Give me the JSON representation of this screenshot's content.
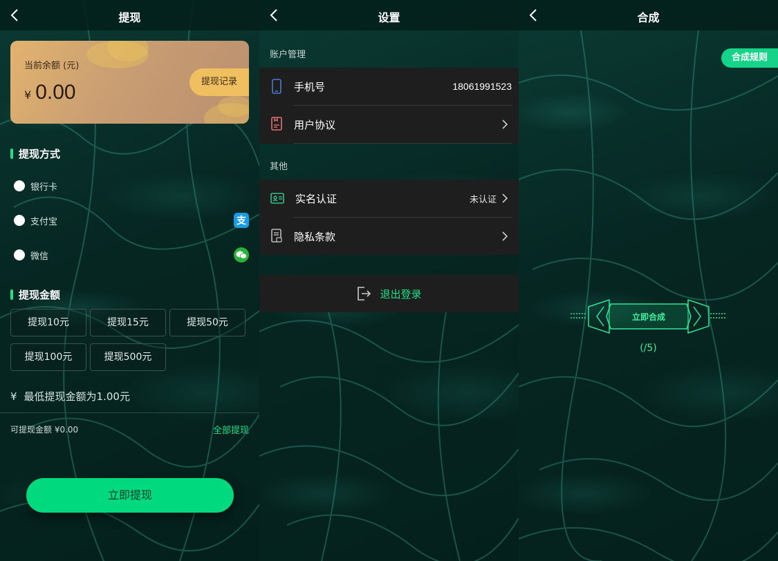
{
  "withdraw": {
    "title": "提现",
    "balance_label": "当前余额 (元)",
    "currency": "¥",
    "balance": "0.00",
    "record_button": "提现记录",
    "method_title": "提现方式",
    "methods": [
      {
        "label": "银行卡",
        "icon": ""
      },
      {
        "label": "支付宝",
        "icon": "alipay-icon"
      },
      {
        "label": "微信",
        "icon": "wechat-icon"
      }
    ],
    "amount_title": "提现金额",
    "amounts": [
      "提现10元",
      "提现15元",
      "提现50元",
      "提现100元",
      "提现500元"
    ],
    "min_yen": "¥",
    "min_text": "最低提现金额为1.00元",
    "available_text": "可提现金额 ¥0.00",
    "withdraw_all": "全部提现",
    "submit": "立即提现",
    "accent": "#00d97e"
  },
  "settings": {
    "title": "设置",
    "account_group": "账户管理",
    "phone_label": "手机号",
    "phone_value": "18061991523",
    "agreement_label": "用户协议",
    "other_group": "其他",
    "realname_label": "实名认证",
    "realname_status": "未认证",
    "privacy_label": "隐私条款",
    "logout_label": "退出登录"
  },
  "synth": {
    "title": "合成",
    "rules_button": "合成规则",
    "action_label": "立即合成",
    "count": "(/5)"
  }
}
